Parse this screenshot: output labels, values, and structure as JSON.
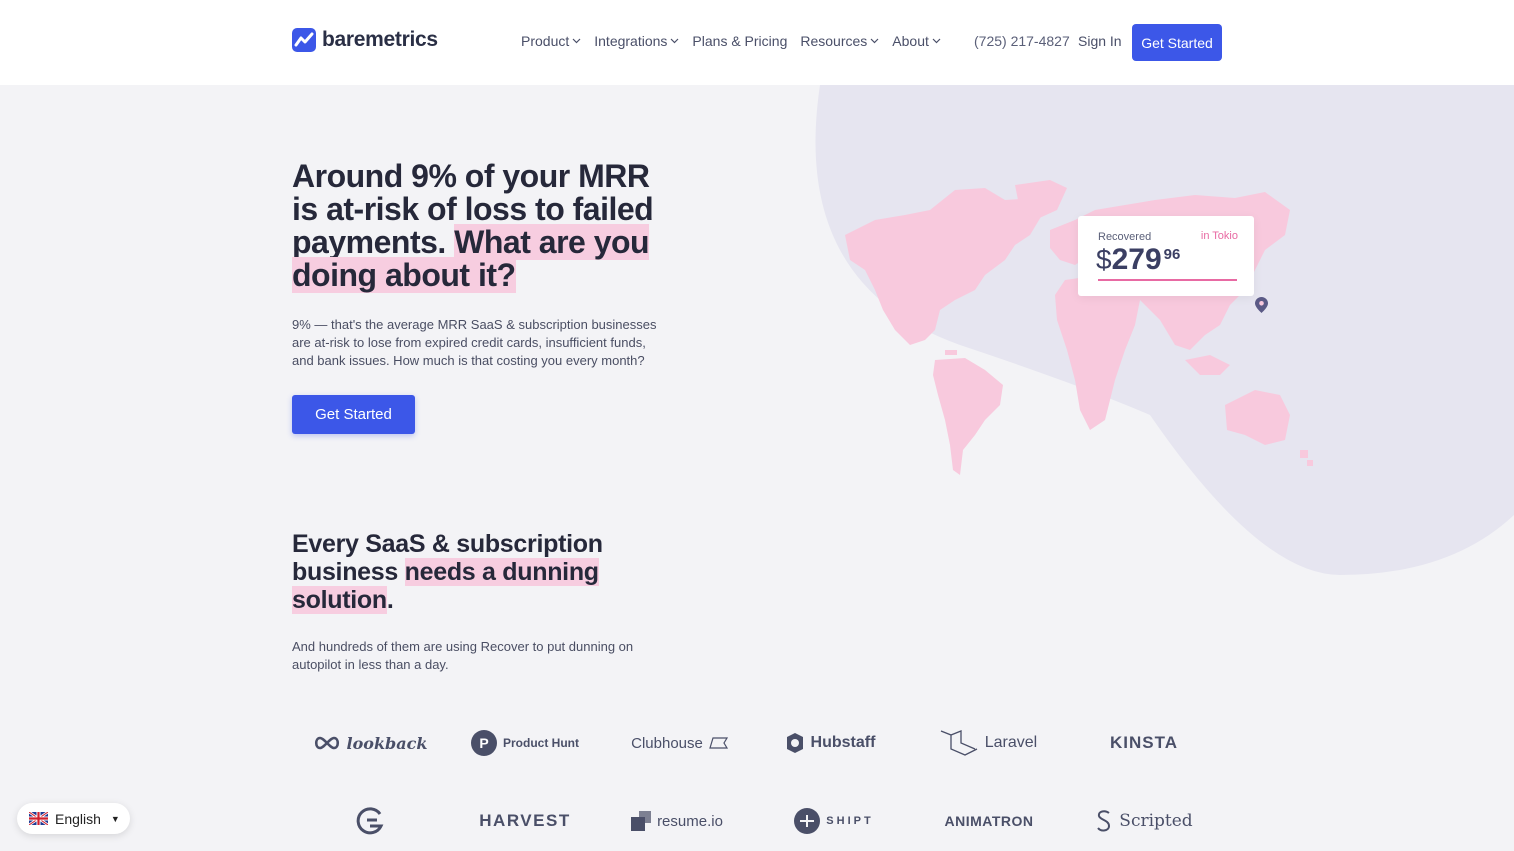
{
  "header": {
    "logo_text": "baremetrics",
    "nav": [
      {
        "label": "Product",
        "has_dropdown": true
      },
      {
        "label": "Integrations",
        "has_dropdown": true
      },
      {
        "label": "Plans & Pricing",
        "has_dropdown": false
      },
      {
        "label": "Resources",
        "has_dropdown": true
      },
      {
        "label": "About",
        "has_dropdown": true
      }
    ],
    "phone": "(725) 217-4827",
    "signin_label": "Sign In",
    "cta_label": "Get Started"
  },
  "hero": {
    "title_plain": "Around 9% of your MRR is at-risk of loss to failed payments.",
    "title_highlight": "What are you doing about it?",
    "description": "9% — that's the average MRR SaaS & subscription businesses are at-risk to lose from expired credit cards, insufficient funds, and bank issues. How much is that costing you every month?",
    "cta_label": "Get Started"
  },
  "recovered_card": {
    "label": "Recovered",
    "location": "in Tokio",
    "currency": "$",
    "amount_int": "279",
    "amount_dec": "96"
  },
  "section2": {
    "title_plain_1": "Every SaaS & subscription business",
    "title_highlight": "needs a dunning solution",
    "title_plain_2": ".",
    "description": "And hundreds of them are using Recover to put dunning on autopilot in less than a day."
  },
  "customer_logos": {
    "row1": [
      "lookback",
      "Product Hunt",
      "Clubhouse",
      "Hubstaff",
      "Laravel",
      "KINSTA"
    ],
    "row2": [
      "",
      "HARVEST",
      "resume.io",
      "SHIPT",
      "ANIMATRON",
      "Scripted"
    ]
  },
  "language": {
    "label": "English"
  },
  "colors": {
    "accent": "#3c57e8",
    "highlight": "#f7cde0",
    "pink": "#e86aa3",
    "map": "#f8c9dd",
    "blob": "#e6e5f0"
  }
}
